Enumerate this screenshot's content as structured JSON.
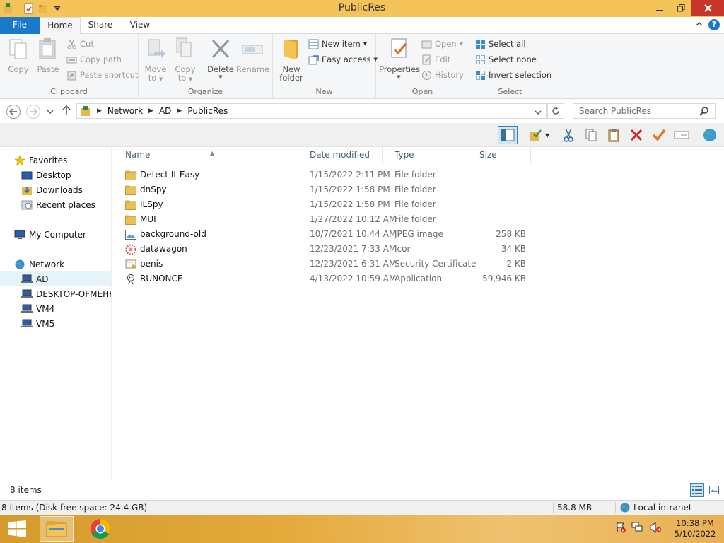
{
  "window": {
    "title": "PublicRes"
  },
  "ribbon_tabs": [
    "File",
    "Home",
    "Share",
    "View"
  ],
  "ribbon": {
    "clipboard": {
      "label": "Clipboard",
      "copy": "Copy",
      "paste": "Paste",
      "cut": "Cut",
      "copy_path": "Copy path",
      "paste_shortcut": "Paste shortcut"
    },
    "organize": {
      "label": "Organize",
      "move_to_1": "Move",
      "move_to_2": "to",
      "copy_to_1": "Copy",
      "copy_to_2": "to",
      "delete": "Delete",
      "rename": "Rename"
    },
    "new": {
      "label": "New",
      "new_folder_1": "New",
      "new_folder_2": "folder",
      "new_item": "New item",
      "easy_access": "Easy access"
    },
    "open": {
      "label": "Open",
      "properties": "Properties",
      "open": "Open",
      "edit": "Edit",
      "history": "History"
    },
    "select": {
      "label": "Select",
      "select_all": "Select all",
      "select_none": "Select none",
      "invert_selection": "Invert selection"
    }
  },
  "address": {
    "crumbs": [
      "Network",
      "AD",
      "PublicRes"
    ],
    "search_placeholder": "Search PublicRes"
  },
  "nav": {
    "favorites": "Favorites",
    "desktop": "Desktop",
    "downloads": "Downloads",
    "recent": "Recent places",
    "my_computer": "My Computer",
    "network": "Network",
    "hosts": [
      "AD",
      "DESKTOP-OFMEHRC",
      "VM4",
      "VM5"
    ]
  },
  "columns": {
    "name": "Name",
    "date": "Date modified",
    "type": "Type",
    "size": "Size"
  },
  "files": [
    {
      "name": "Detect It Easy",
      "date": "1/15/2022 2:11 PM",
      "type": "File folder",
      "size": "",
      "icon": "folder-icon"
    },
    {
      "name": "dnSpy",
      "date": "1/15/2022 1:58 PM",
      "type": "File folder",
      "size": "",
      "icon": "folder-icon"
    },
    {
      "name": "ILSpy",
      "date": "1/15/2022 1:58 PM",
      "type": "File folder",
      "size": "",
      "icon": "folder-icon"
    },
    {
      "name": "MUI",
      "date": "1/27/2022 10:12 AM",
      "type": "File folder",
      "size": "",
      "icon": "folder-icon"
    },
    {
      "name": "background-old",
      "date": "10/7/2021 10:44 AM",
      "type": "JPEG image",
      "size": "258 KB",
      "icon": "image-file-icon"
    },
    {
      "name": "datawagon",
      "date": "12/23/2021 7:33 AM",
      "type": "Icon",
      "size": "34 KB",
      "icon": "icon-file-icon"
    },
    {
      "name": "penis",
      "date": "12/23/2021 6:31 AM",
      "type": "Security Certificate",
      "size": "2 KB",
      "icon": "certificate-icon"
    },
    {
      "name": "RUNONCE",
      "date": "4/13/2022 10:59 AM",
      "type": "Application",
      "size": "59,946 KB",
      "icon": "application-icon"
    }
  ],
  "status": {
    "item_count": "8 items",
    "disk_info": "8 items (Disk free space: 24.4 GB)",
    "size": "58.8 MB",
    "zone": "Local intranet"
  },
  "taskbar": {
    "time": "10:38 PM",
    "date": "5/10/2022"
  },
  "colors": {
    "titlebar": "#f4c35a",
    "file_tab": "#1979ca",
    "close_button": "#c7362a",
    "folder": "#e8b64a"
  }
}
